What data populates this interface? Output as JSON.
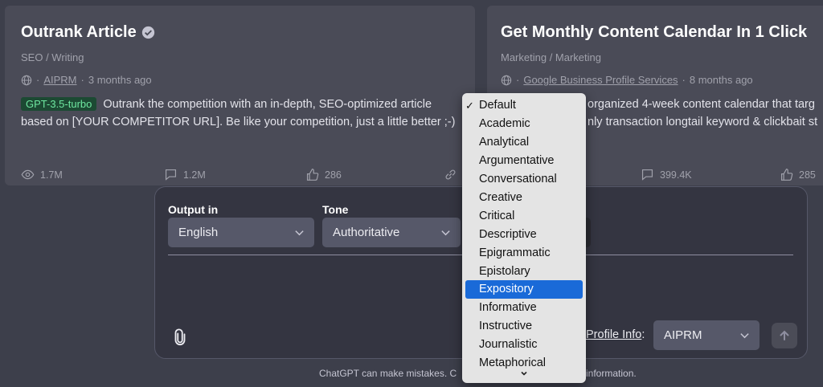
{
  "cards": [
    {
      "title": "Outrank Article",
      "category": "SEO / Writing",
      "author": "AIPRM",
      "age": "3 months ago",
      "badge": "GPT-3.5-turbo",
      "desc_line1": "Outrank the competition with an in-depth, SEO-optimized article",
      "desc_line2": "based on [YOUR COMPETITOR URL]. Be like your competition, just a little better ;-)",
      "views": "1.7M",
      "comments": "1.2M",
      "likes": "286"
    },
    {
      "title": "Get Monthly Content Calendar In 1 Click",
      "category": "Marketing / Marketing",
      "author": "Google Business Profile Services",
      "age": "8 months ago",
      "desc_line1": "organized 4-week content calendar that targ",
      "desc_line2": "nly transaction longtail keyword & clickbait st",
      "comments": "399.4K",
      "likes": "285"
    }
  ],
  "composer": {
    "output_label": "Output in",
    "output_value": "English",
    "tone_label": "Tone",
    "tone_value": "Authoritative",
    "profile_label": "Profile Info",
    "profile_colon": ":",
    "profile_value": "AIPRM"
  },
  "footer": {
    "left": "ChatGPT can make mistakes. C",
    "right": "information."
  },
  "tone_dropdown": {
    "checkmark": "✓",
    "options": [
      "Default",
      "Academic",
      "Analytical",
      "Argumentative",
      "Conversational",
      "Creative",
      "Critical",
      "Descriptive",
      "Epigrammatic",
      "Epistolary",
      "Expository",
      "Informative",
      "Instructive",
      "Journalistic",
      "Metaphorical"
    ],
    "selected": "Default",
    "highlighted": "Expository"
  },
  "colors": {
    "badge_bg": "#1c4a33",
    "badge_text": "#6ee7a0",
    "highlight": "#1a6ad8"
  }
}
